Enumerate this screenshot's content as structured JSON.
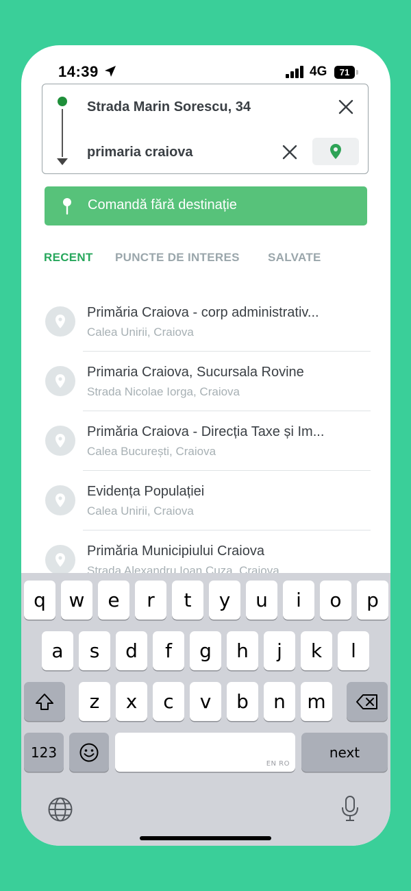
{
  "status_bar": {
    "time": "14:39",
    "network": "4G",
    "battery": "71"
  },
  "search": {
    "origin": "Strada Marin Sorescu, 34",
    "destination": "primaria craiova"
  },
  "cta": {
    "label": "Comandă fără destinație"
  },
  "tabs": [
    {
      "label": "RECENT",
      "active": true
    },
    {
      "label": "PUNCTE DE INTERES",
      "active": false
    },
    {
      "label": "SALVATE",
      "active": false
    }
  ],
  "results": [
    {
      "title": "Primăria Craiova - corp administrativ...",
      "subtitle": "Calea Unirii, Craiova"
    },
    {
      "title": "Primaria Craiova, Sucursala Rovine",
      "subtitle": "Strada Nicolae Iorga, Craiova"
    },
    {
      "title": "Primăria Craiova - Direcția Taxe și Im...",
      "subtitle": "Calea București, Craiova"
    },
    {
      "title": "Evidența Populației",
      "subtitle": "Calea Unirii, Craiova"
    },
    {
      "title": "Primăria Municipiului Craiova",
      "subtitle": "Strada Alexandru Ioan Cuza, Craiova"
    }
  ],
  "keyboard": {
    "row1": [
      "q",
      "w",
      "e",
      "r",
      "t",
      "y",
      "u",
      "i",
      "o",
      "p"
    ],
    "row2": [
      "a",
      "s",
      "d",
      "f",
      "g",
      "h",
      "j",
      "k",
      "l"
    ],
    "row3": [
      "z",
      "x",
      "c",
      "v",
      "b",
      "n",
      "m"
    ],
    "numbers_label": "123",
    "space_language": "EN RO",
    "return_label": "next"
  },
  "colors": {
    "background": "#3acf99",
    "accent": "#57c27a",
    "active_tab": "#27a75c"
  }
}
